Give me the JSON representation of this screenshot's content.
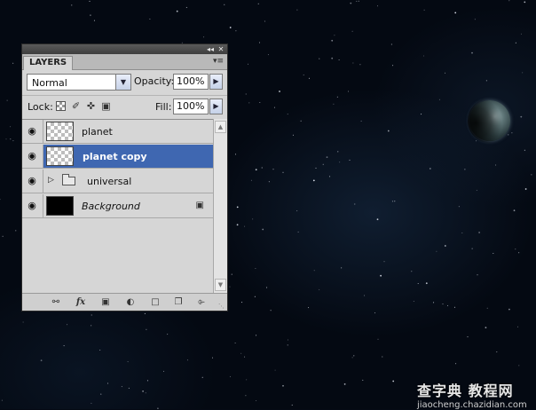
{
  "panel": {
    "tab_title": "LAYERS",
    "titlebar_icons": [
      "collapse-icon",
      "close-icon"
    ],
    "blend_mode": {
      "value": "Normal",
      "options_visible": [
        "Normal"
      ]
    },
    "opacity": {
      "label": "Opacity:",
      "value": "100%"
    },
    "lock": {
      "label": "Lock:",
      "icons": [
        "lock-transparent-pixels-icon",
        "lock-image-pixels-icon",
        "lock-position-icon",
        "lock-all-icon"
      ]
    },
    "fill": {
      "label": "Fill:",
      "value": "100%"
    },
    "layers": [
      {
        "name": "planet",
        "visible": true,
        "selected": false,
        "type": "pixel"
      },
      {
        "name": "planet  copy",
        "visible": true,
        "selected": true,
        "type": "pixel"
      },
      {
        "name": "universal",
        "visible": true,
        "selected": false,
        "type": "group"
      },
      {
        "name": "Background",
        "visible": true,
        "selected": false,
        "type": "background",
        "locked": true
      }
    ],
    "bottom_icons": [
      "link-layers-icon",
      "fx-icon",
      "add-mask-icon",
      "adjustment-layer-icon",
      "new-group-icon",
      "new-layer-icon",
      "delete-layer-icon"
    ],
    "fx_label": "fx"
  },
  "colors": {
    "selected_row": "#3f67b1",
    "panel_bg": "#d6d6d6",
    "space_bg": "#040912"
  },
  "watermark": {
    "line1": "查字典 教程网",
    "line2": "jiaocheng.chazidian.com"
  }
}
